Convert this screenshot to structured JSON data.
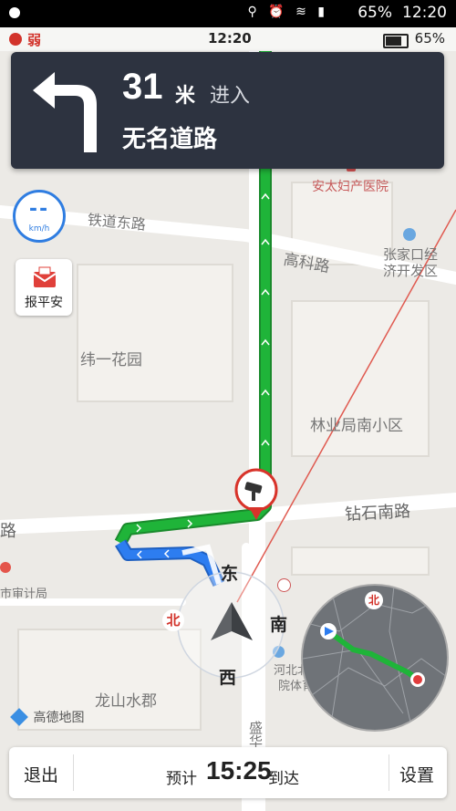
{
  "status_bar": {
    "icons": "⚲ ⏰ ≋ ▮",
    "battery": "65%",
    "time": "12:20"
  },
  "nav_status": {
    "signal_icon": "gps-signal-icon",
    "signal": "弱",
    "clock": "12:20",
    "battery": "65%"
  },
  "guidance": {
    "turn_icon": "turn-left-arrow-icon",
    "distance": "31",
    "unit": "米",
    "action": "进入",
    "road": "无名道路"
  },
  "speed": {
    "value": "--",
    "unit": "km/h"
  },
  "safe_report": {
    "label": "报平安",
    "icon": "envelope-icon"
  },
  "map": {
    "roads": [
      "铁道东路",
      "高科路",
      "钻石南路"
    ],
    "places": [
      "纬一花园",
      "林业局南小区",
      "龙山水郡",
      "张家口经",
      "济开发区",
      "河北北方学",
      "院体育馆",
      "安太妇产医院",
      "市审计局",
      "东柳路",
      "盛华"
    ],
    "camera_icon": "traffic-camera-icon"
  },
  "compass": {
    "north": "北",
    "east": "东",
    "south": "南",
    "west": "西"
  },
  "overview": {
    "north": "北"
  },
  "brand": {
    "logo": "高德地图"
  },
  "bottom_bar": {
    "exit": "退出",
    "eta_prefix": "预计",
    "eta_time": "15:25",
    "eta_suffix": "到达",
    "settings": "设置"
  },
  "colors": {
    "route_green": "#1fb439",
    "route_blue": "#2d7df0",
    "panel": "#2d3340",
    "accent_red": "#d2332b"
  }
}
